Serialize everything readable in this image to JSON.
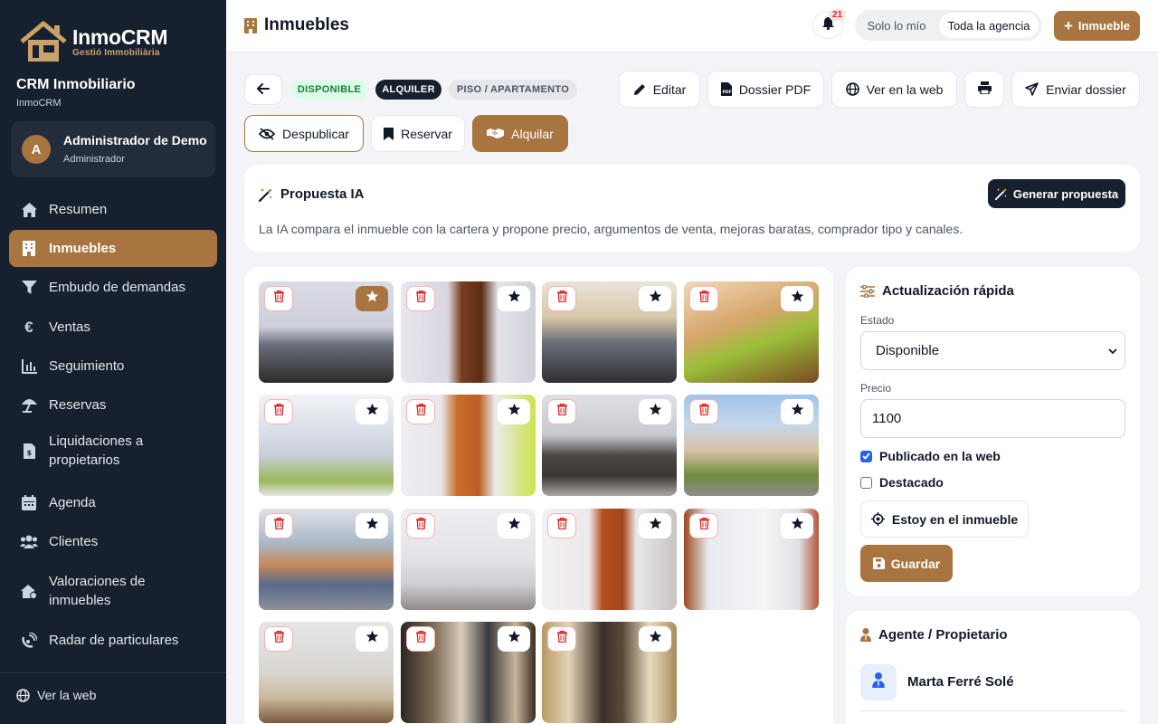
{
  "app": {
    "logo_title": "InmoCRM",
    "logo_subtitle": "Gestió Immobiliària",
    "crm_title": "CRM Inmobiliario",
    "crm_subtitle": "InmoCRM"
  },
  "user": {
    "initial": "A",
    "name": "Administrador de Demo",
    "role": "Administrador"
  },
  "sidebar": {
    "items": [
      {
        "label": "Resumen",
        "icon": "home-icon",
        "active": false
      },
      {
        "label": "Inmuebles",
        "icon": "building-icon",
        "active": true
      },
      {
        "label": "Embudo de demandas",
        "icon": "funnel-icon",
        "active": false
      },
      {
        "label": "Ventas",
        "icon": "euro-icon",
        "active": false
      },
      {
        "label": "Seguimiento",
        "icon": "chart-icon",
        "active": false
      },
      {
        "label": "Reservas",
        "icon": "umbrella-icon",
        "active": false
      },
      {
        "label": "Liquidaciones a propietarios",
        "icon": "invoice-icon",
        "active": false
      },
      {
        "label": "Agenda",
        "icon": "calendar-icon",
        "active": false
      },
      {
        "label": "Clientes",
        "icon": "users-icon",
        "active": false
      },
      {
        "label": "Valoraciones de inmuebles",
        "icon": "house-valuation-icon",
        "active": false
      },
      {
        "label": "Radar de particulares",
        "icon": "radar-icon",
        "active": false
      }
    ],
    "web_link": "Ver la web"
  },
  "header": {
    "title": "Inmuebles",
    "notifications_count": "21",
    "scope_mine": "Solo lo mío",
    "scope_agency": "Toda la agencia",
    "new_button": "Inmueble"
  },
  "badges": {
    "status": "DISPONIBLE",
    "operation": "ALQUILER",
    "type": "PISO / APARTAMENTO"
  },
  "actions": {
    "edit": "Editar",
    "dossier_pdf": "Dossier PDF",
    "view_web": "Ver en la web",
    "send_dossier": "Enviar dossier",
    "unpublish": "Despublicar",
    "reserve": "Reservar",
    "rent": "Alquilar"
  },
  "ai": {
    "title": "Propuesta IA",
    "button": "Generar propuesta",
    "description": "La IA compara el inmueble con la cartera y propone precio, argumentos de venta, mejoras baratas, comprador tipo y canales."
  },
  "photos": [
    {
      "scene": "kitchen-living",
      "featured": true
    },
    {
      "scene": "entrance-door",
      "featured": false
    },
    {
      "scene": "kitchen",
      "featured": false
    },
    {
      "scene": "bedroom-green",
      "featured": false
    },
    {
      "scene": "bedroom-window",
      "featured": false
    },
    {
      "scene": "bedroom-wardrobe",
      "featured": false
    },
    {
      "scene": "living-sofa",
      "featured": false
    },
    {
      "scene": "street",
      "featured": false
    },
    {
      "scene": "kitchen-blue",
      "featured": false
    },
    {
      "scene": "hallway",
      "featured": false
    },
    {
      "scene": "room-door",
      "featured": false
    },
    {
      "scene": "bathroom",
      "featured": false
    },
    {
      "scene": "bathroom-shower",
      "featured": false
    },
    {
      "scene": "corridor-stairs",
      "featured": false
    },
    {
      "scene": "building-entrance",
      "featured": false
    }
  ],
  "quick_update": {
    "title": "Actualización rápida",
    "status_label": "Estado",
    "status_value": "Disponible",
    "price_label": "Precio",
    "price_value": "1100",
    "published_label": "Publicado en la web",
    "published": true,
    "featured_label": "Destacado",
    "featured": false,
    "here_button": "Estoy en el inmueble",
    "save_button": "Guardar"
  },
  "agent": {
    "title": "Agente / Propietario",
    "name": "Marta Ferré Solé"
  },
  "colors": {
    "accent": "#a8743f",
    "sidebar": "#17202e",
    "dark_badge": "#17202e",
    "status_green": "#15803d"
  }
}
